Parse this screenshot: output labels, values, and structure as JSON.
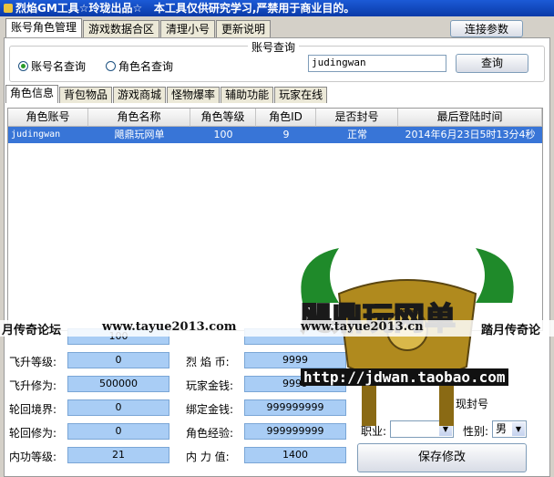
{
  "window": {
    "title": "烈焰GM工具☆玲珑出品☆",
    "disclaimer": "本工具仅供研究学习,严禁用于商业目的。"
  },
  "top_tabs": [
    {
      "label": "账号角色管理",
      "active": true
    },
    {
      "label": "游戏数据合区",
      "active": false
    },
    {
      "label": "清理小号",
      "active": false
    },
    {
      "label": "更新说明",
      "active": false
    }
  ],
  "connect_button": "连接参数",
  "query": {
    "group_title": "账号查询",
    "radio_account": "账号名查询",
    "radio_role": "角色名查询",
    "selected": "account",
    "input_value": "judingwan",
    "query_button": "查询"
  },
  "sub_tabs": [
    {
      "label": "角色信息",
      "active": true
    },
    {
      "label": "背包物品",
      "active": false
    },
    {
      "label": "游戏商城",
      "active": false
    },
    {
      "label": "怪物爆率",
      "active": false
    },
    {
      "label": "辅助功能",
      "active": false
    },
    {
      "label": "玩家在线",
      "active": false
    }
  ],
  "grid": {
    "columns": [
      "角色账号",
      "角色名称",
      "角色等级",
      "角色ID",
      "是否封号",
      "最后登陆时间"
    ],
    "rows": [
      [
        "judingwan",
        "飓鼎玩网单",
        "100",
        "9",
        "正常",
        "2014年6月23日5时13分4秒"
      ]
    ]
  },
  "watermark": {
    "left": "月传奇论坛",
    "mid1": "www.tayue2013.com",
    "mid2": "www.tayue2013.cn",
    "right": "踏月传奇论",
    "logo_text": "飓鼎玩网单",
    "logo_url": "http://jdwan.taobao.com"
  },
  "fields": {
    "row0_value": "100",
    "fly_level_label": "飞升等级:",
    "fly_level_value": "0",
    "fly_xiuwei_label": "飞升修为:",
    "fly_xiuwei_value": "500000",
    "reincarnation_label": "轮回境界:",
    "reincarnation_value": "0",
    "reincarnation_xiuwei_label": "轮回修为:",
    "reincarnation_xiuwei_value": "0",
    "neigong_label": "内功等级:",
    "neigong_value": "21",
    "lieyan_coin_label": "烈 焰 币:",
    "lieyan_coin_value": "9999",
    "player_gold_label": "玩家金钱:",
    "player_gold_value": "9999",
    "bound_gold_label": "绑定金钱:",
    "bound_gold_value": "999999999",
    "role_exp_label": "角色经验:",
    "role_exp_value": "999999999",
    "inner_power_label": "内 力 值:",
    "inner_power_value": "1400",
    "seal_fragment": "现封号",
    "job_label": "职业:",
    "gender_label": "性别:",
    "gender_value": "男",
    "save_button": "保存修改"
  },
  "colors": {
    "title_bar": "#0a3aa8",
    "selected_row": "#3875d7",
    "field_fill": "#a9cdf5"
  }
}
